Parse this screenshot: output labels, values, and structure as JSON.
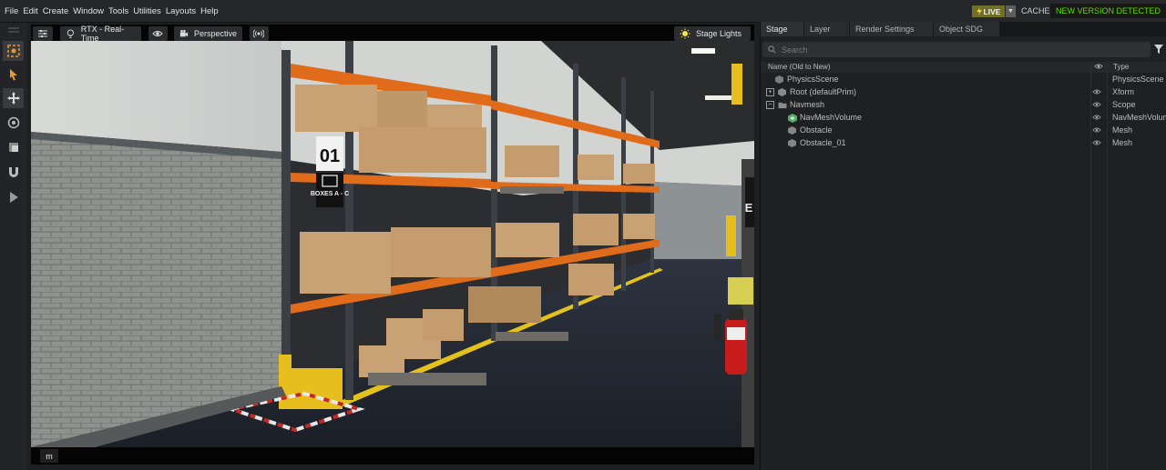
{
  "menu": [
    "File",
    "Edit",
    "Create",
    "Window",
    "Tools",
    "Utilities",
    "Layouts",
    "Help"
  ],
  "status": {
    "live_label": "LIVE",
    "cache_label": "CACHE:",
    "cache_status": "NEW VERSION DETECTED"
  },
  "viewport": {
    "render_mode": "RTX - Real-Time",
    "camera": "Perspective",
    "stage_lights": "Stage Lights",
    "bottom_key": "m",
    "signage": {
      "aisle_number": "01",
      "aisle_label": "BOXES A - C",
      "edge_label": "E"
    }
  },
  "stage_panel": {
    "tabs": [
      "Stage",
      "Layer",
      "Render Settings",
      "Object SDG"
    ],
    "search_placeholder": "Search",
    "columns": {
      "name": "Name (Old to New)",
      "type": "Type"
    },
    "rows": [
      {
        "name": "PhysicsScene",
        "type": "PhysicsScene",
        "indent": 1,
        "expander": "",
        "icon": "physics-scene-icon",
        "eye": false
      },
      {
        "name": "Root (defaultPrim)",
        "type": "Xform",
        "indent": 0,
        "expander": "+",
        "icon": "xform-icon",
        "eye": true
      },
      {
        "name": "Navmesh",
        "type": "Scope",
        "indent": 0,
        "expander": "−",
        "icon": "folder-icon",
        "eye": true
      },
      {
        "name": "NavMeshVolume",
        "type": "NavMeshVolume",
        "indent": 2,
        "expander": "",
        "icon": "navmesh-volume-icon",
        "eye": true
      },
      {
        "name": "Obstacle",
        "type": "Mesh",
        "indent": 2,
        "expander": "",
        "icon": "mesh-icon",
        "eye": true
      },
      {
        "name": "Obstacle_01",
        "type": "Mesh",
        "indent": 2,
        "expander": "",
        "icon": "mesh-icon",
        "eye": true
      }
    ]
  },
  "colors": {
    "accent_green": "#5edc00",
    "live_bg": "#6f6f2a",
    "panel_bg": "#1f2022"
  }
}
